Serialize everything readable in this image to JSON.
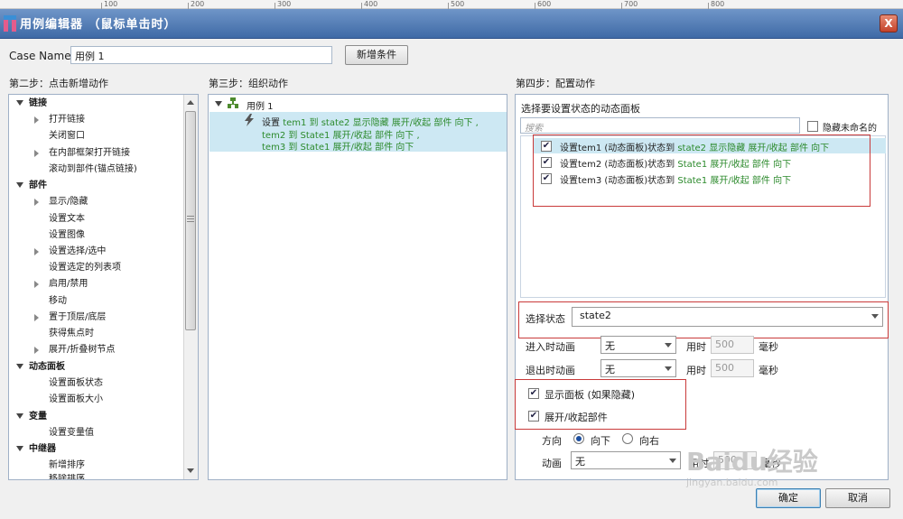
{
  "ruler": {
    "ticks": [
      "100",
      "200",
      "300",
      "400",
      "500",
      "600",
      "700",
      "800"
    ]
  },
  "window": {
    "title": "用例编辑器 （鼠标单击时）",
    "close_label": "X"
  },
  "case": {
    "label": "Case Name",
    "value": "用例 1",
    "add_condition": "新增条件"
  },
  "step2": {
    "heading": "第二步：点击新增动作",
    "groups": [
      {
        "label": "链接",
        "items": [
          {
            "label": "打开链接",
            "expandable": true
          },
          {
            "label": "关闭窗口",
            "expandable": false
          },
          {
            "label": "在内部框架打开链接",
            "expandable": true
          },
          {
            "label": "滚动到部件(锚点链接)",
            "expandable": false
          }
        ]
      },
      {
        "label": "部件",
        "items": [
          {
            "label": "显示/隐藏",
            "expandable": true
          },
          {
            "label": "设置文本",
            "expandable": false
          },
          {
            "label": "设置图像",
            "expandable": false
          },
          {
            "label": "设置选择/选中",
            "expandable": true
          },
          {
            "label": "设置选定的列表项",
            "expandable": false
          },
          {
            "label": "启用/禁用",
            "expandable": true
          },
          {
            "label": "移动",
            "expandable": false
          },
          {
            "label": "置于顶层/底层",
            "expandable": true
          },
          {
            "label": "获得焦点时",
            "expandable": false
          },
          {
            "label": "展开/折叠树节点",
            "expandable": true
          }
        ]
      },
      {
        "label": "动态面板",
        "items": [
          {
            "label": "设置面板状态",
            "expandable": false
          },
          {
            "label": "设置面板大小",
            "expandable": false
          }
        ]
      },
      {
        "label": "变量",
        "items": [
          {
            "label": "设置变量值",
            "expandable": false
          }
        ]
      },
      {
        "label": "中继器",
        "items": [
          {
            "label": "新增排序",
            "expandable": false
          },
          {
            "label": "移除排序",
            "expandable": false
          }
        ]
      }
    ]
  },
  "step3": {
    "heading": "第三步：组织动作",
    "case_label": "用例 1",
    "action_line1_prefix": "设置 ",
    "action_line1_green": "tem1 到 state2 显示隐藏 展开/收起 部件 向下 ,",
    "action_line2": "tem2 到 State1 展开/收起 部件 向下 ,",
    "action_line3": "tem3 到 State1 展开/收起 部件 向下"
  },
  "step4": {
    "heading": "第四步：配置动作",
    "panel_heading": "选择要设置状态的动态面板",
    "search_placeholder": "搜索",
    "hide_unnamed": "隐藏未命名的",
    "rows": [
      {
        "prefix": "设置tem1 (动态面板)状态到 ",
        "value": "state2 显示隐藏 展开/收起 部件 向下",
        "checked": true
      },
      {
        "prefix": "设置tem2 (动态面板)状态到 ",
        "value": "State1 展开/收起 部件 向下",
        "checked": true
      },
      {
        "prefix": "设置tem3 (动态面板)状态到 ",
        "value": "State1 展开/收起 部件 向下",
        "checked": true
      }
    ],
    "select_state_label": "选择状态",
    "select_state_value": "state2",
    "enter_anim_label": "进入时动画",
    "enter_anim_value": "无",
    "exit_anim_label": "退出时动画",
    "exit_anim_value": "无",
    "time_label": "用时",
    "time_value": "500",
    "ms_label": "毫秒",
    "show_panel": "显示面板 (如果隐藏)",
    "expand_collapse": "展开/收起部件",
    "direction_label": "方向",
    "dir_down": "向下",
    "dir_right": "向右",
    "anim_label": "动画",
    "anim_value": "无",
    "time2_label": "用时",
    "time2_value": "500",
    "ms2_label": "毫秒"
  },
  "footer": {
    "ok": "确定",
    "cancel": "取消"
  },
  "watermark": {
    "text": "Baidu经验",
    "url": "jingyan.baidu.com"
  },
  "colors": {
    "titlebar": "#4a74b0",
    "selection": "#cde8f3",
    "green_text": "#2c8a2c",
    "highlight_box": "#c93a3a"
  }
}
